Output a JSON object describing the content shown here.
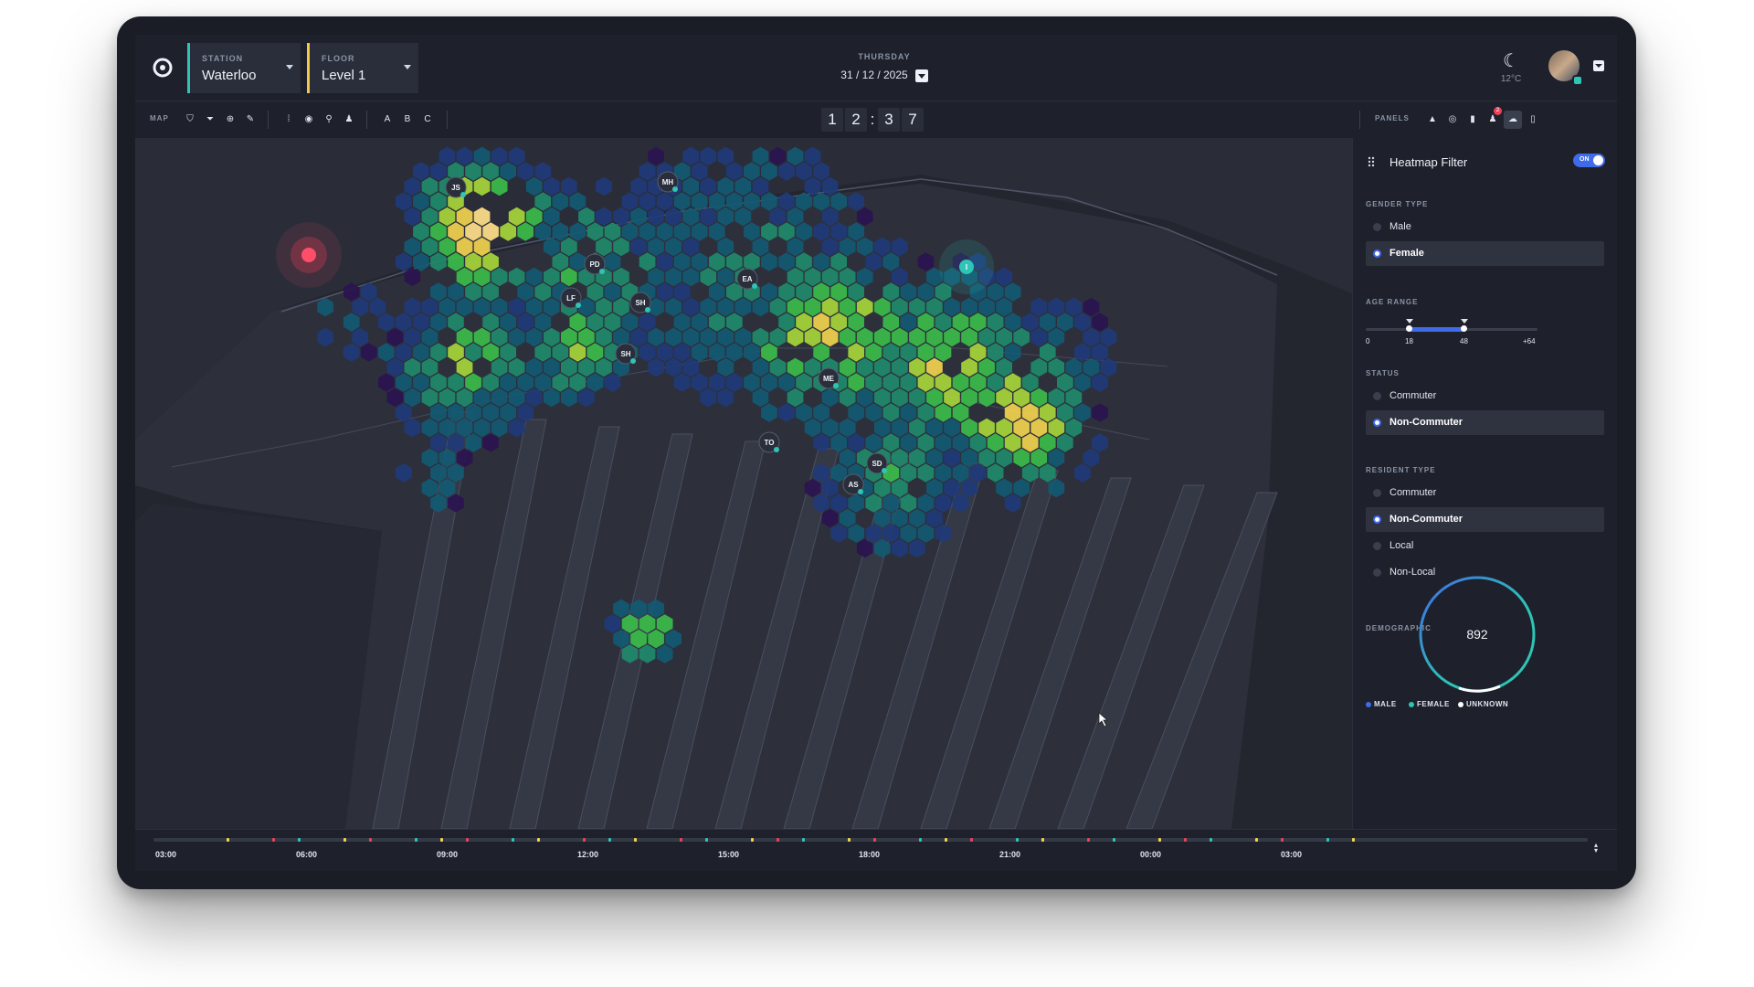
{
  "header": {
    "station": {
      "label": "STATION",
      "value": "Waterloo"
    },
    "floor": {
      "label": "FLOOR",
      "value": "Level 1"
    },
    "date": {
      "day": "THURSDAY",
      "value": "31 / 12 / 2025"
    },
    "weather": {
      "temp": "12°C",
      "icon": "moon-icon"
    }
  },
  "toolbar": {
    "map_label": "MAP",
    "panels_label": "PANELS",
    "zones": [
      "A",
      "B",
      "C"
    ],
    "clock": [
      "1",
      "2",
      "3",
      "7"
    ],
    "alert_count": "2"
  },
  "map": {
    "people": [
      "JS",
      "MH",
      "PD",
      "LF",
      "SH",
      "SH",
      "EA",
      "ME",
      "TO",
      "SD",
      "AS",
      "I"
    ],
    "heat_colors": [
      "#2b1450",
      "#1f3b7a",
      "#145a74",
      "#1f8a6a",
      "#3bbd4a",
      "#a7d63a",
      "#f2d24e",
      "#ffe08a"
    ]
  },
  "panel": {
    "title": "Heatmap Filter",
    "toggle": "ON",
    "gender": {
      "label": "GENDER TYPE",
      "options": [
        "Male",
        "Female"
      ],
      "selected": "Female"
    },
    "age": {
      "label": "AGE RANGE",
      "min": "0",
      "low": "18",
      "high": "48",
      "max": "+64"
    },
    "status": {
      "label": "STATUS",
      "options": [
        "Commuter",
        "Non-Commuter"
      ],
      "selected": "Non-Commuter"
    },
    "resident": {
      "label": "RESIDENT TYPE",
      "options": [
        "Commuter",
        "Non-Commuter",
        "Local",
        "Non-Local"
      ],
      "selected": "Non-Commuter"
    },
    "demographic": {
      "label": "DEMOGRAPHIC",
      "total": "892",
      "legend": [
        "MALE",
        "FEMALE",
        "UNKNOWN"
      ],
      "legend_colors": [
        "#3f6be8",
        "#2ec4b6",
        "#ffffff"
      ]
    }
  },
  "timeline": {
    "labels": [
      "03:00",
      "06:00",
      "09:00",
      "12:00",
      "15:00",
      "18:00",
      "21:00",
      "00:00",
      "03:00"
    ]
  }
}
